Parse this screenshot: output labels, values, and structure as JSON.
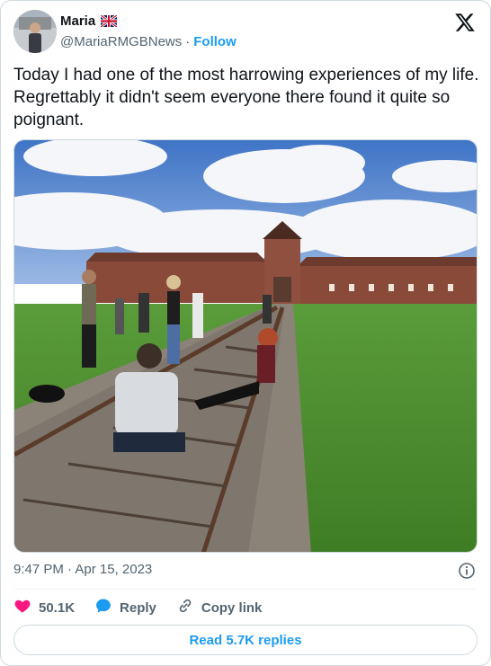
{
  "author": {
    "name": "Maria",
    "flag": "🇬🇧",
    "handle": "@MariaRMGBNews",
    "separator": "·",
    "follow_label": "Follow"
  },
  "brand": {
    "logo_icon": "x-logo-icon"
  },
  "tweet": {
    "text": "Today I had one of the most harrowing experiences of my life. Regrettably it didn't seem everyone there found it quite so poignant."
  },
  "media": {
    "kind": "photo"
  },
  "timestamp": "9:47 PM · Apr 15, 2023",
  "actions": {
    "like_count": "50.1K",
    "reply_label": "Reply",
    "copy_label": "Copy link"
  },
  "read_replies_label": "Read 5.7K replies",
  "colors": {
    "accent": "#1d9bf0",
    "like": "#f91880",
    "text": "#0f1419",
    "muted": "#536471",
    "border": "#cfd9de"
  }
}
